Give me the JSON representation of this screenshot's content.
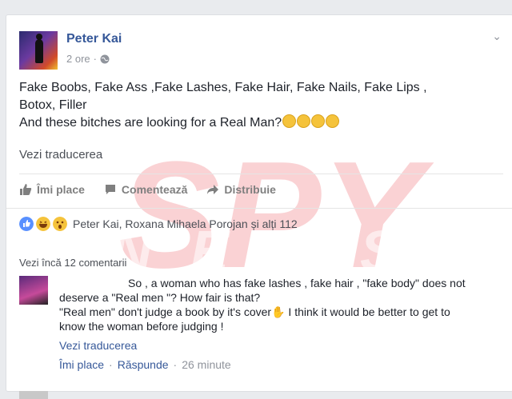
{
  "post": {
    "author": "Peter Kai",
    "time": "2 ore",
    "lines": [
      "Fake Boobs, Fake Ass ,Fake Lashes, Fake Hair, Fake Nails, Fake Lips ,",
      "Botox, Filler",
      "And these bitches are looking for a Real Man?"
    ],
    "emoji_count": 4,
    "see_translation": "Vezi traducerea"
  },
  "actions": {
    "like": "Îmi place",
    "comment": "Comentează",
    "share": "Distribuie"
  },
  "reactions": {
    "summary": "Peter Kai, Roxana Mihaela Porojan și alți 112",
    "types": [
      "like-icon",
      "haha-icon",
      "wow-icon"
    ],
    "colors": {
      "like": "#5890ff",
      "haha": "#f5c33b",
      "wow": "#f5c33b"
    }
  },
  "comments": {
    "view_more": "Vezi încă 12 comentarii",
    "items": [
      {
        "lines": [
          "So , a woman who has fake lashes , fake hair , \"fake body\" does not",
          "deserve a \"Real men \"? How fair is that?",
          "\"Real men\" don't judge a book by it's cover✋ I think it would be better to get to",
          "know the woman before judging !"
        ],
        "see_translation": "Vezi traducerea",
        "like": "Îmi place",
        "dot": "·",
        "reply": "Răspunde",
        "time": "26 minute"
      }
    ]
  },
  "watermark": {
    "line1": "SPY",
    "line2": "NEWS",
    "color": "#e8323c"
  },
  "theme": {
    "link": "#365899",
    "muted": "#90949c"
  }
}
